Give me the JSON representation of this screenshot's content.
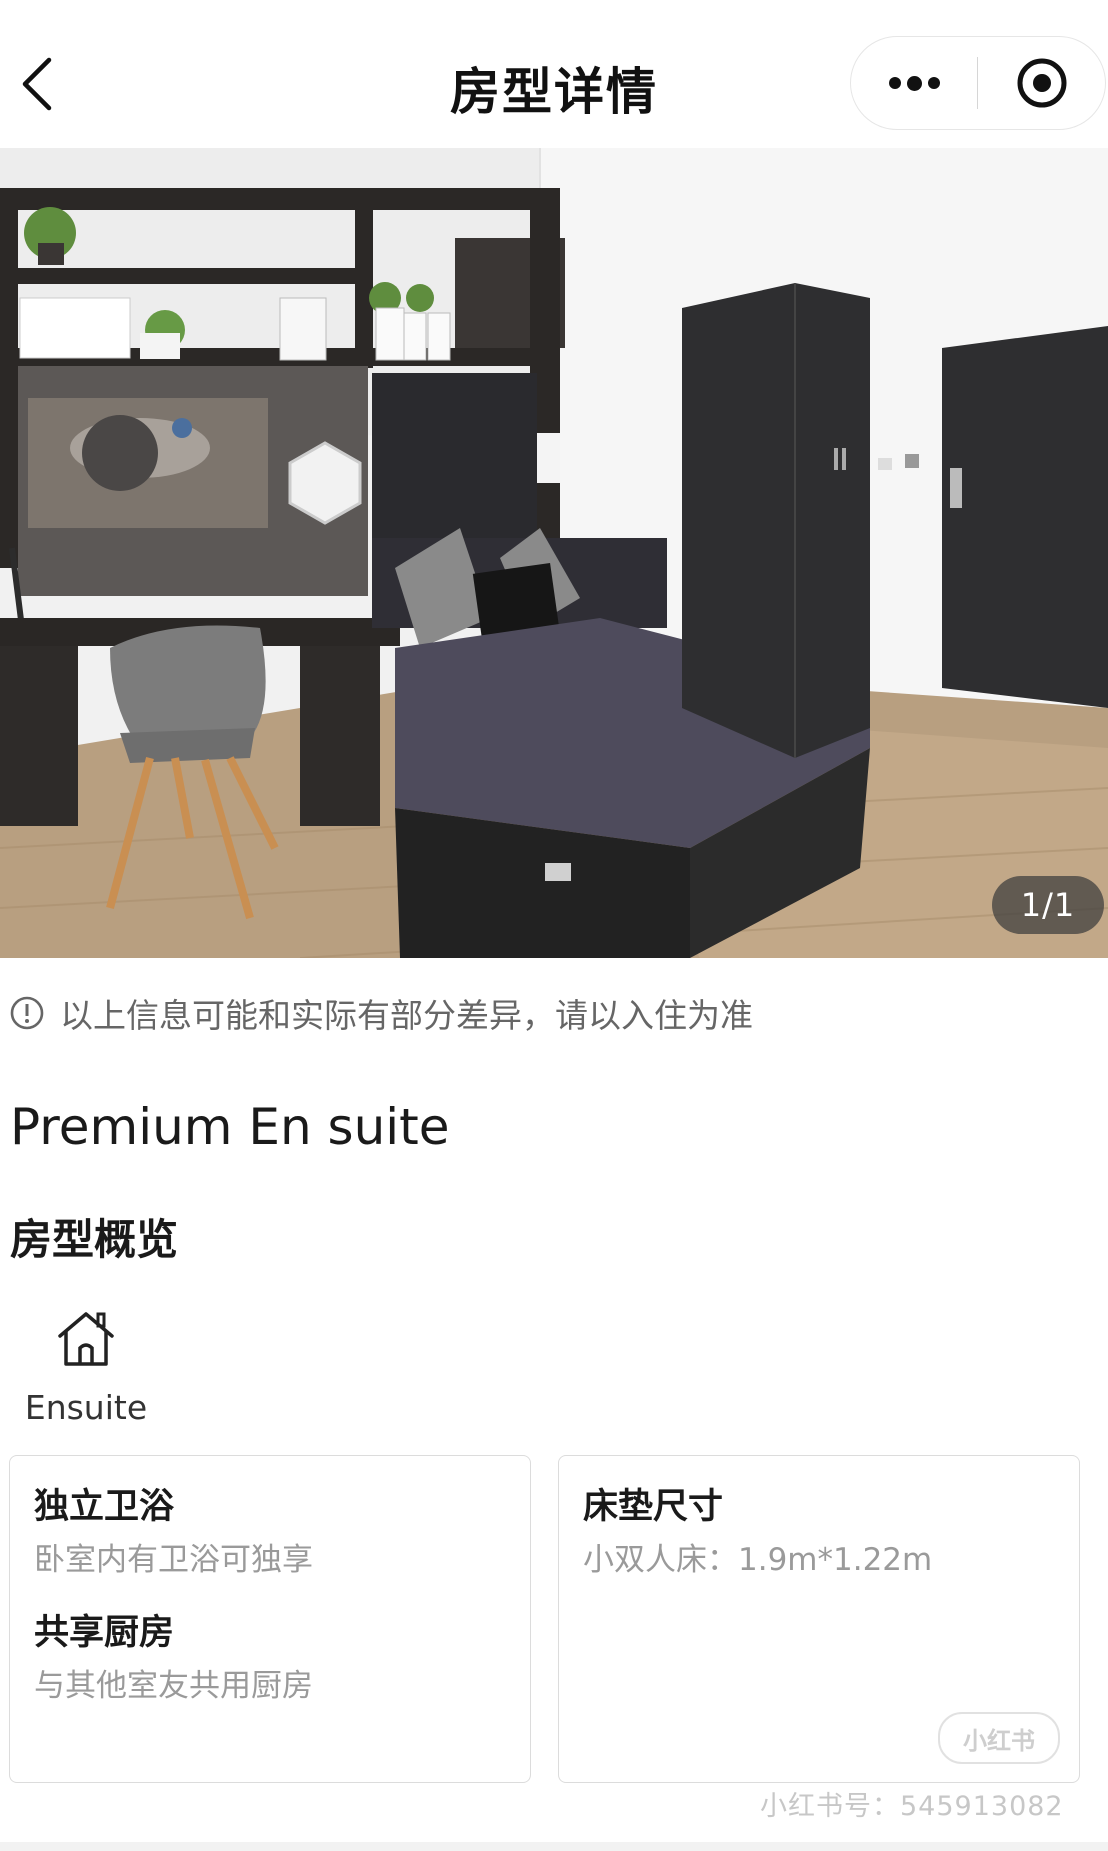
{
  "header": {
    "title": "房型详情",
    "back_icon": "chevron-left-icon",
    "more_icon": "more-dots-icon",
    "close_icon": "target-circle-icon"
  },
  "gallery": {
    "counter": "1/1",
    "current": 1,
    "total": 1
  },
  "disclaimer": {
    "text": "以上信息可能和实际有部分差异，请以入住为准",
    "icon": "info-circle-icon"
  },
  "room": {
    "name": "Premium En suite"
  },
  "overview": {
    "title": "房型概览",
    "features": [
      {
        "icon": "house-icon",
        "label": "Ensuite"
      }
    ]
  },
  "cards": [
    {
      "items": [
        {
          "title": "独立卫浴",
          "desc": "卧室内有卫浴可独享"
        },
        {
          "title": "共享厨房",
          "desc": "与其他室友共用厨房"
        }
      ]
    },
    {
      "items": [
        {
          "title": "床垫尺寸",
          "desc": "小双人床：1.9m*1.22m"
        }
      ]
    }
  ],
  "watermark": {
    "logo": "小红书",
    "id": "小红书号：545913082"
  },
  "colors": {
    "title": "#111111",
    "muted": "#9a9a9a",
    "border": "#dcdcdc"
  }
}
